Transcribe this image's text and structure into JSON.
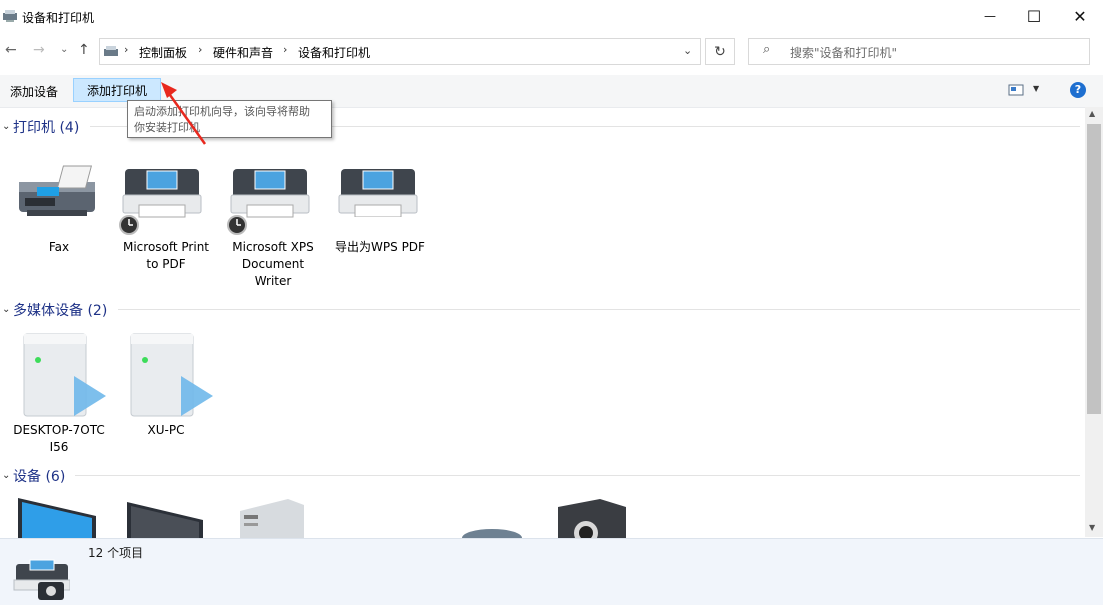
{
  "window": {
    "title": "设备和打印机",
    "minimize": "—",
    "maximize": "☐",
    "close": "✕"
  },
  "address": {
    "crumbs": [
      "控制面板",
      "硬件和声音",
      "设备和打印机"
    ],
    "search_placeholder": "搜索\"设备和打印机\""
  },
  "toolbar": {
    "add_device": "添加设备",
    "add_printer": "添加打印机",
    "help": "?"
  },
  "tooltip": {
    "line1": "启动添加打印机向导，该向导将帮助",
    "line2": "你安装打印机"
  },
  "groups": {
    "printers": {
      "title": "打印机 (4)",
      "items": [
        {
          "label_lines": [
            "Fax"
          ],
          "icon": "fax-icon"
        },
        {
          "label_lines": [
            "Microsoft Print",
            "to PDF"
          ],
          "icon": "printer-icon"
        },
        {
          "label_lines": [
            "Microsoft XPS",
            "Document",
            "Writer"
          ],
          "icon": "printer-icon"
        },
        {
          "label_lines": [
            "导出为WPS PDF"
          ],
          "icon": "printer-icon"
        }
      ]
    },
    "media": {
      "title": "多媒体设备 (2)",
      "items": [
        {
          "label_lines": [
            "DESKTOP-7OTC",
            "I56"
          ],
          "icon": "media-server-icon"
        },
        {
          "label_lines": [
            "XU-PC"
          ],
          "icon": "media-server-icon"
        }
      ]
    },
    "devices": {
      "title": "设备 (6)"
    }
  },
  "status": {
    "count": "12 个项目"
  },
  "colors": {
    "group_title": "#1e3287",
    "selected_button_bg": "#cce8ff",
    "accent_arrow": "#e8281e"
  }
}
